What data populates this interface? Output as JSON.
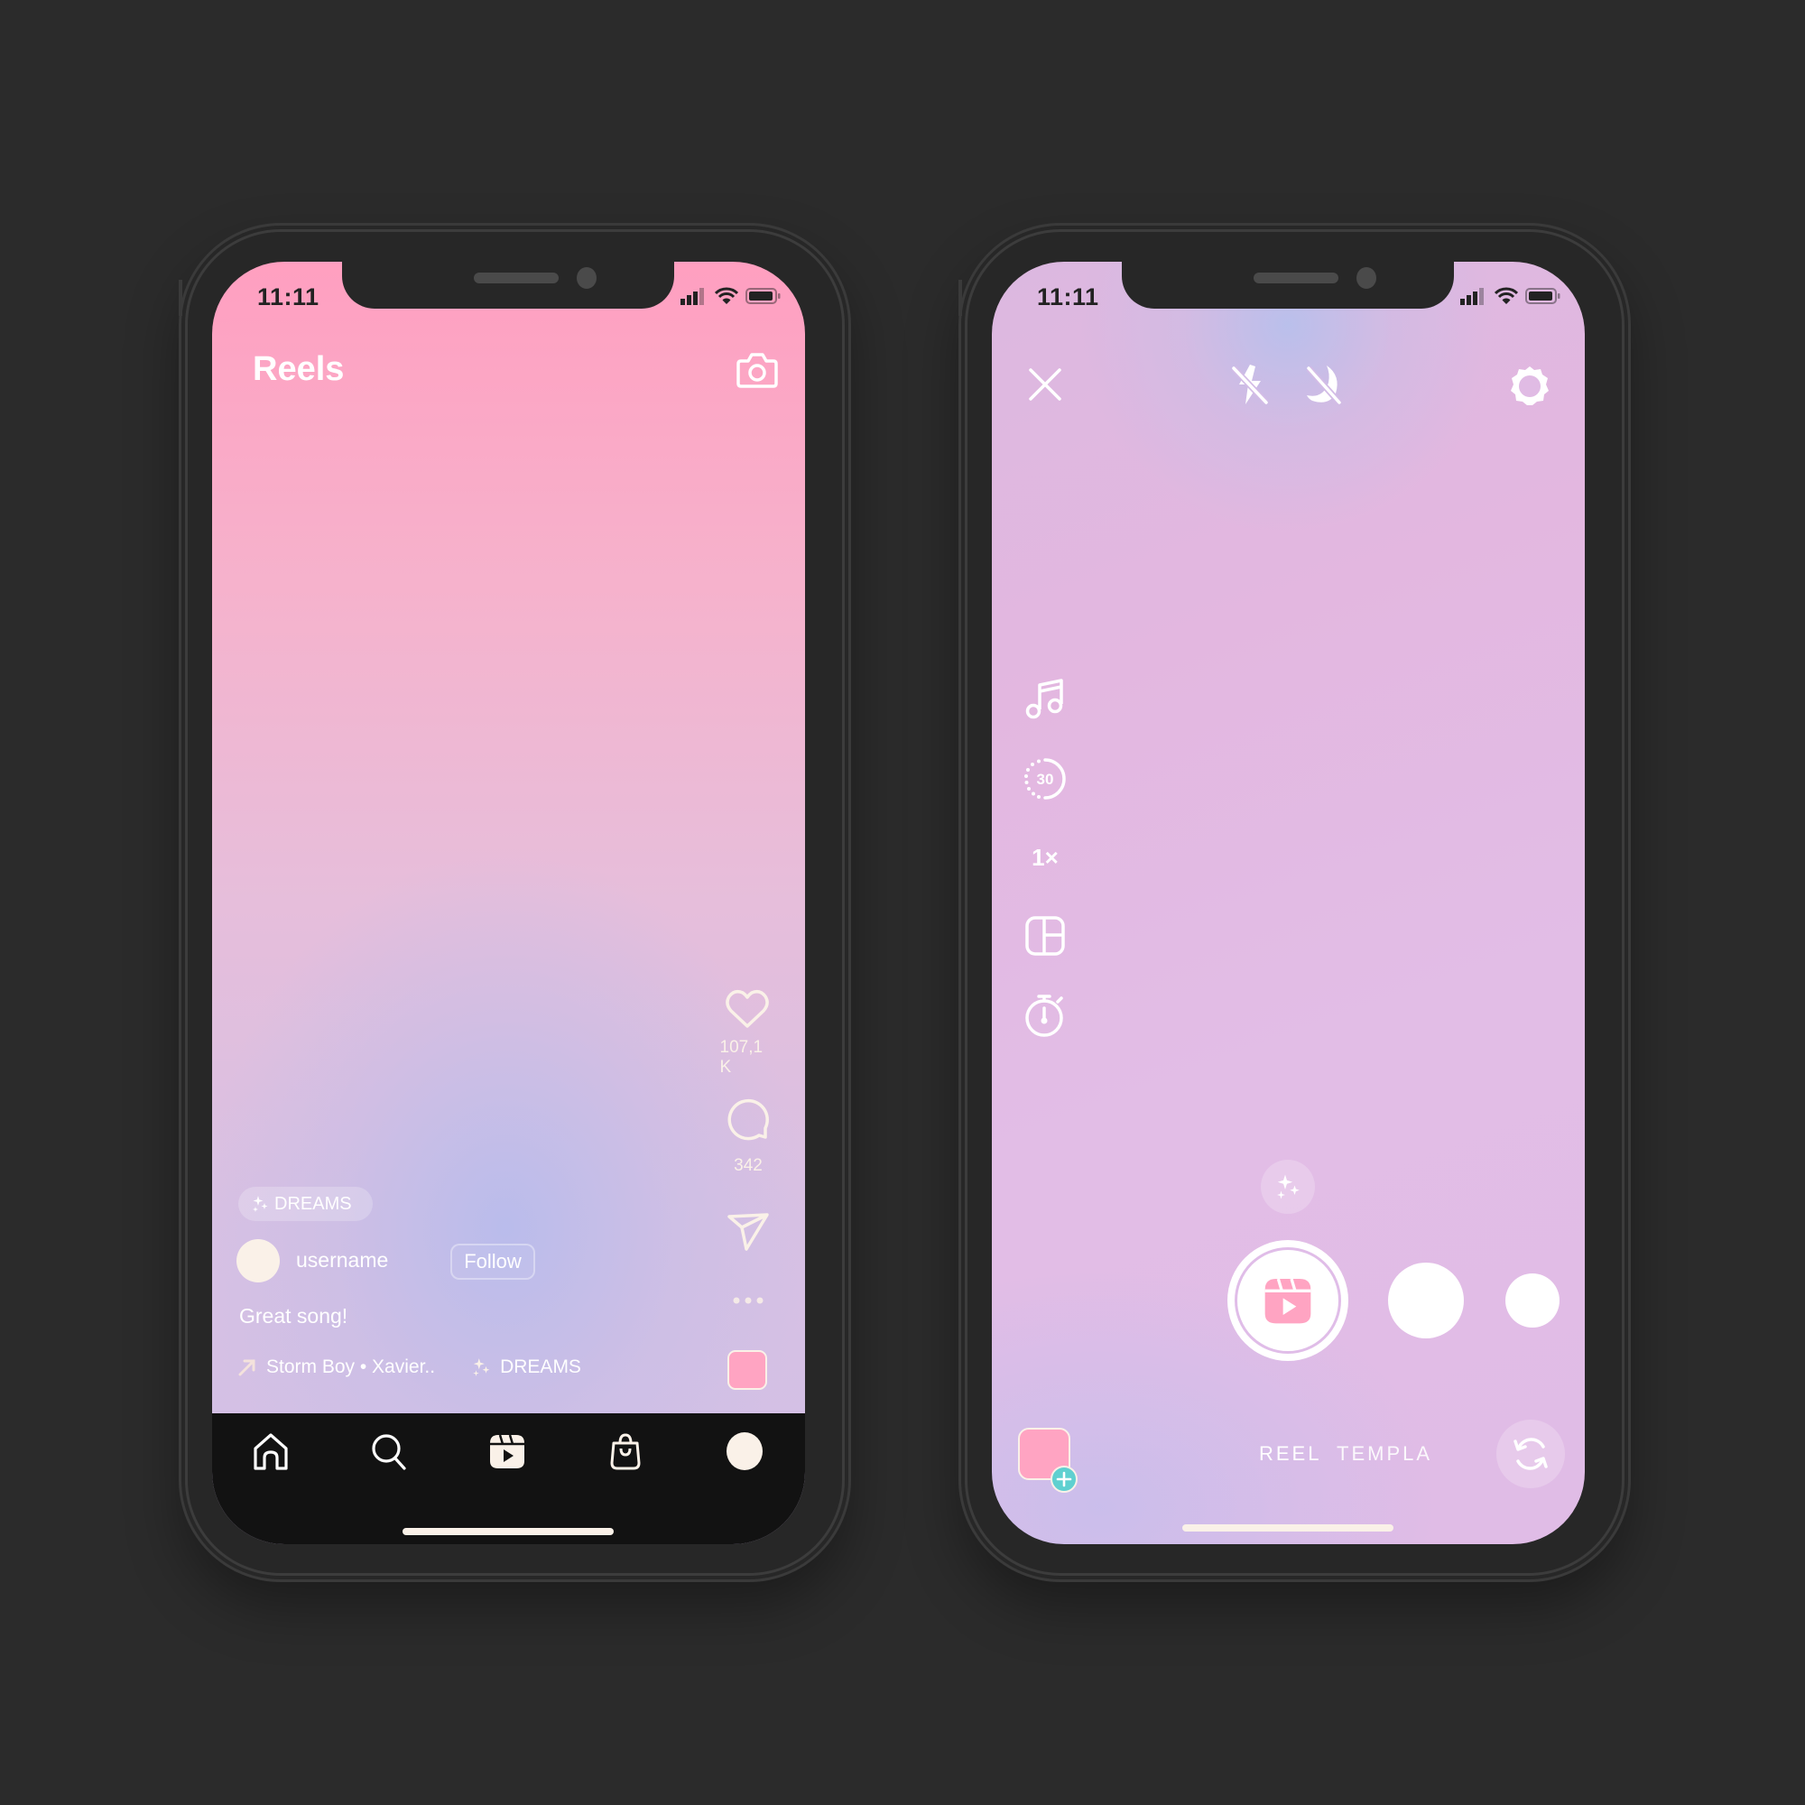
{
  "status_bar": {
    "time": "11:11"
  },
  "reels_screen": {
    "title": "Reels",
    "camera_icon": "camera-icon",
    "actions": {
      "like_count": "107,1 K",
      "comment_count": "342",
      "like_icon": "heart-icon",
      "comment_icon": "comment-icon",
      "share_icon": "send-icon",
      "more_icon": "more-dots-icon"
    },
    "effect_chip": {
      "icon": "sparkles-icon",
      "label": "DREAMS"
    },
    "author": {
      "username": "username",
      "follow_label": "Follow"
    },
    "caption": "Great song!",
    "music": {
      "icon": "arrow-up-right-icon",
      "track": "Storm Boy • Xavier..",
      "effect_icon": "sparkles-icon",
      "effect": "DREAMS"
    },
    "colors": {
      "accent_pink": "#ffa4c2",
      "cream": "#faf1e8",
      "nav_bg": "#121212"
    },
    "bottom_nav": [
      {
        "name": "home",
        "icon": "home-icon"
      },
      {
        "name": "search",
        "icon": "search-icon"
      },
      {
        "name": "reels",
        "icon": "reels-icon"
      },
      {
        "name": "shop",
        "icon": "shopping-bag-icon"
      },
      {
        "name": "profile",
        "icon": "profile-avatar"
      }
    ]
  },
  "camera_screen": {
    "top_bar": {
      "close_icon": "close-icon",
      "flash_icon": "flash-off-icon",
      "night_icon": "night-mode-off-icon",
      "settings_icon": "settings-gear-icon"
    },
    "side_tools": [
      {
        "name": "audio",
        "icon": "music-note-icon"
      },
      {
        "name": "length",
        "icon": "timer-30-icon",
        "label": "30"
      },
      {
        "name": "speed",
        "icon": "speed-icon",
        "label": "1×"
      },
      {
        "name": "layout",
        "icon": "layout-icon"
      },
      {
        "name": "countdown",
        "icon": "stopwatch-icon"
      }
    ],
    "effects_icon": "sparkles-icon",
    "record_icon": "reels-icon",
    "modes": [
      "REEL",
      "TEMPLA"
    ],
    "gallery_icon": "add-plus-icon",
    "flip_icon": "flip-camera-icon",
    "colors": {
      "record_pink": "#ffa4c2",
      "add_badge": "#5fd0d0"
    }
  }
}
